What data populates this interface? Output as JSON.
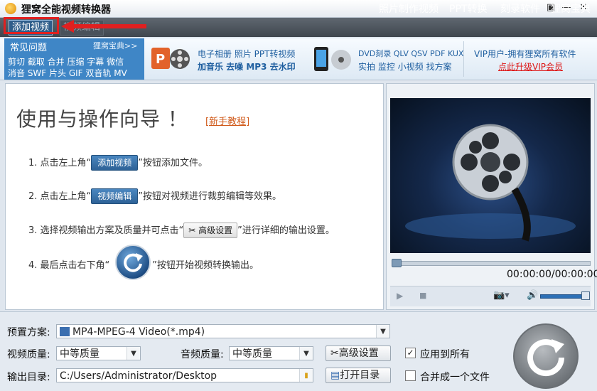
{
  "app": {
    "title": "狸窝全能视频转换器"
  },
  "window_controls": {
    "restore": "▣",
    "minimize": "—",
    "close": "✕"
  },
  "toolbar": {
    "add_video": "添加视频",
    "edit_video": "视频编辑",
    "right_items": [
      "照片制作视频",
      "PPT转换",
      "刻录软件",
      "狸窝宝典"
    ]
  },
  "banner": {
    "faq_title": "常见问题",
    "faq_more": "狸窝宝典>>",
    "faq_lines": [
      "剪切 截取 合并 压缩 字幕 微信",
      "消音 SWF 片头 GIF 双音轨 MV"
    ],
    "ad1_lines": [
      "电子相册 照片 PPT转视频",
      "加音乐 去噪 MP3 去水印"
    ],
    "ad2_lines": [
      "DVD刻录 QLV QSV PDF KUX",
      "实拍 监控 小视频 找方案"
    ],
    "vip_line": "VIP用户-拥有狸窝所有软件",
    "vip_link": "点此升级VIP会员"
  },
  "guide": {
    "title": "使用与操作向导 ！",
    "tutorial_link": "[新手教程]",
    "step1_pre": "1. 点击左上角“",
    "step1_btn": "添加视频",
    "step1_post": "”按钮添加文件。",
    "step2_pre": "2. 点击左上角“",
    "step2_btn": "视频编辑",
    "step2_post": "”按钮对视频进行裁剪编辑等效果。",
    "step3_pre": "3. 选择视频输出方案及质量并可点击“",
    "step3_btn": "高级设置",
    "step3_post": "”进行详细的输出设置。",
    "step4_pre": "4. 最后点击右下角“",
    "step4_post": "”按钮开始视频转换输出。"
  },
  "player": {
    "time": "00:00:00/00:00:00",
    "progress": 0
  },
  "settings": {
    "preset_label": "预置方案:",
    "preset_value": "MP4-MPEG-4 Video(*.mp4)",
    "video_quality_label": "视频质量:",
    "video_quality_value": "中等质量",
    "audio_quality_label": "音频质量:",
    "audio_quality_value": "中等质量",
    "advanced_button": "高级设置",
    "apply_all_label": "应用到所有",
    "apply_all_checked": true,
    "output_dir_label": "输出目录:",
    "output_dir_value": "C:/Users/Administrator/Desktop",
    "open_dir_button": "打开目录",
    "merge_label": "合并成一个文件",
    "merge_checked": false
  },
  "colors": {
    "accent": "#3f86c6",
    "highlight": "#e02020",
    "link": "#d05a1a"
  }
}
